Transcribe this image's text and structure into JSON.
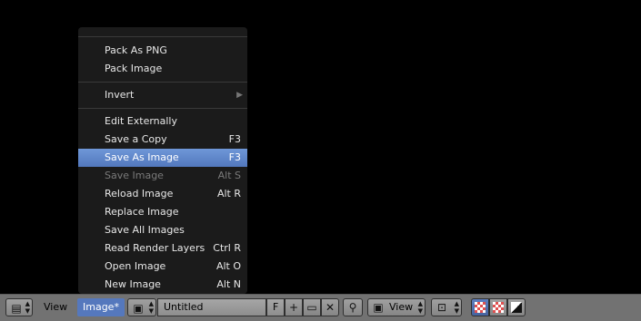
{
  "image_menu": {
    "items_group1": [
      {
        "label": "Pack As PNG",
        "shortcut": ""
      },
      {
        "label": "Pack Image",
        "shortcut": ""
      }
    ],
    "invert_label": "Invert",
    "items_group2": [
      {
        "label": "Edit Externally",
        "shortcut": ""
      },
      {
        "label": "Save a Copy",
        "shortcut": "F3"
      },
      {
        "label": "Save As Image",
        "shortcut": "F3"
      },
      {
        "label": "Save Image",
        "shortcut": "Alt S"
      },
      {
        "label": "Reload Image",
        "shortcut": "Alt R"
      },
      {
        "label": "Replace Image",
        "shortcut": ""
      },
      {
        "label": "Save All Images",
        "shortcut": ""
      },
      {
        "label": "Read Render Layers",
        "shortcut": "Ctrl R"
      },
      {
        "label": "Open Image",
        "shortcut": "Alt O"
      },
      {
        "label": "New Image",
        "shortcut": "Alt N"
      }
    ],
    "highlighted": "Save As Image",
    "disabled": "Save Image"
  },
  "header": {
    "view_label": "View",
    "image_label": "Image*",
    "image_name": "Untitled",
    "fake_user": "F",
    "view_mode_label": "View"
  },
  "colors": {
    "menu_bg": "#1c1c1c",
    "highlight": "#5a7fc4",
    "header_bg": "#727272"
  }
}
